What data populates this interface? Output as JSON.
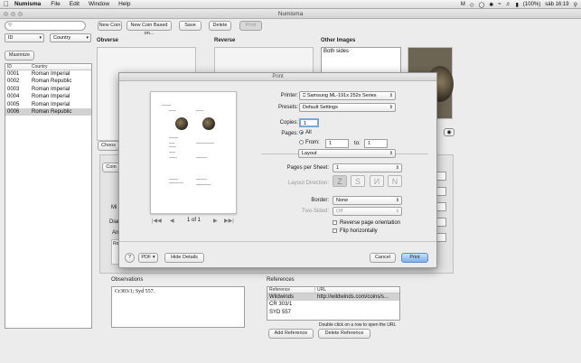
{
  "menubar": {
    "app_name": "Numisma",
    "items": [
      "File",
      "Edit",
      "Window",
      "Help"
    ],
    "battery": "(100%)",
    "clock": "sáb 16:19"
  },
  "window": {
    "title": "Numisma"
  },
  "toolbar": {
    "new_coin": "New Coin",
    "new_coin_based": "New Coin Based on...",
    "save": "Save",
    "delete": "Delete",
    "print": "Print"
  },
  "sidebar": {
    "search_placeholder": "",
    "sort_field": "ID",
    "filter_field": "Country",
    "maximize": "Maximize",
    "columns": [
      "ID",
      "Country"
    ],
    "rows": [
      {
        "id": "0001",
        "country": "Roman Imperial"
      },
      {
        "id": "0002",
        "country": "Roman Republic"
      },
      {
        "id": "0003",
        "country": "Roman Imperial"
      },
      {
        "id": "0004",
        "country": "Roman Imperial"
      },
      {
        "id": "0005",
        "country": "Roman Imperial"
      },
      {
        "id": "0006",
        "country": "Roman Republic"
      }
    ]
  },
  "main": {
    "obverse": "Obverse",
    "reverse": "Reverse",
    "other_images": "Other Images",
    "other_images_item": "Both sides",
    "choose": "Choos",
    "coin_tab": "Coin",
    "mi": "Mi",
    "diam": "Diar",
    "an": "An",
    "ro": "Ro",
    "observations_label": "Observations",
    "observations_text": "Cr303/1; Syd 557.",
    "references_label": "References",
    "ref_columns": [
      "Reference",
      "URL"
    ],
    "ref_rows": [
      {
        "ref": "Wildwinds",
        "url": "http://wildwinds.com/coins/s..."
      },
      {
        "ref": "CR 303/1",
        "url": ""
      },
      {
        "ref": "SYD 557",
        "url": ""
      }
    ],
    "ref_hint": "Double click on a row to open the URL",
    "add_reference": "Add Reference",
    "delete_reference": "Delete Reference"
  },
  "print_dialog": {
    "title": "Print",
    "printer_label": "Printer:",
    "printer_value": "Samsung ML-191x 252x Series",
    "presets_label": "Presets:",
    "presets_value": "Default Settings",
    "copies_label": "Copies:",
    "copies_value": "1",
    "pages_label": "Pages:",
    "pages_all": "All",
    "pages_from": "From:",
    "from_value": "1",
    "to_label": "to:",
    "to_value": "1",
    "section": "Layout",
    "pages_per_sheet_label": "Pages per Sheet:",
    "pages_per_sheet_value": "1",
    "layout_direction_label": "Layout Direction:",
    "border_label": "Border:",
    "border_value": "None",
    "two_sided_label": "Two-Sided:",
    "two_sided_value": "Off",
    "reverse_orientation": "Reverse page orientation",
    "flip_horizontally": "Flip horizontally",
    "page_indicator": "1 of 1",
    "help": "?",
    "pdf": "PDF",
    "hide_details": "Hide Details",
    "cancel": "Cancel",
    "print": "Print"
  }
}
